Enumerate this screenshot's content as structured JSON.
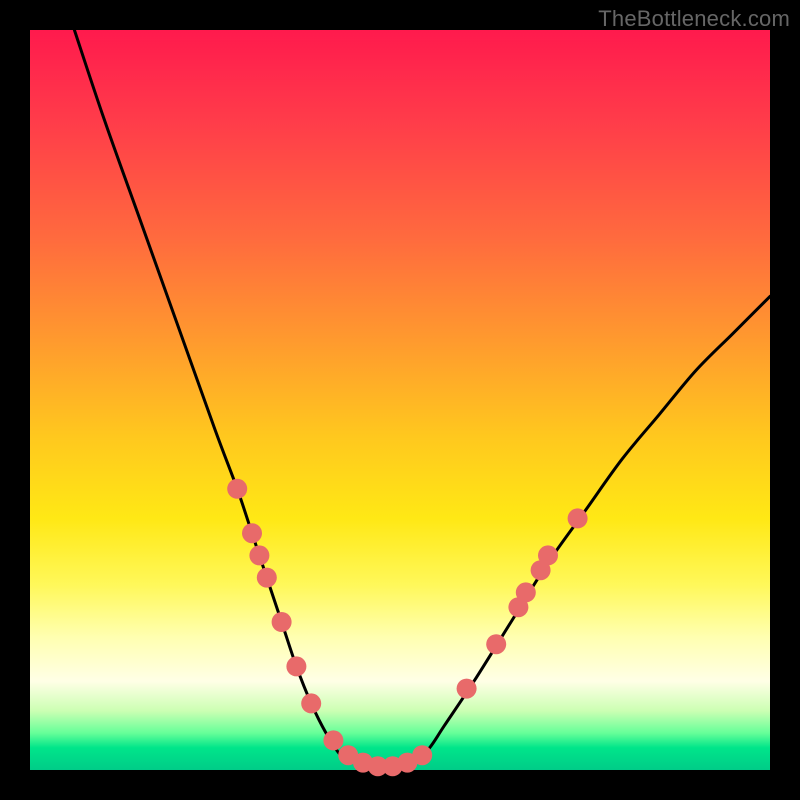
{
  "watermark": "TheBottleneck.com",
  "chart_data": {
    "type": "line",
    "title": "",
    "xlabel": "",
    "ylabel": "",
    "xlim": [
      0,
      100
    ],
    "ylim": [
      0,
      100
    ],
    "grid": false,
    "legend": false,
    "series": [
      {
        "name": "bottleneck-curve",
        "color": "#000000",
        "x": [
          6,
          10,
          15,
          20,
          25,
          28,
          30,
          32,
          34,
          36,
          38,
          40,
          42,
          44,
          46,
          48,
          50,
          52,
          54,
          56,
          60,
          65,
          70,
          75,
          80,
          85,
          90,
          95,
          100
        ],
        "y": [
          100,
          88,
          74,
          60,
          46,
          38,
          32,
          26,
          20,
          14,
          9,
          5,
          2,
          1,
          0,
          0,
          0,
          1,
          3,
          6,
          12,
          20,
          28,
          35,
          42,
          48,
          54,
          59,
          64
        ]
      }
    ],
    "markers": [
      {
        "name": "highlighted-points",
        "color": "#e86a6a",
        "radius": 10,
        "points": [
          {
            "x": 28,
            "y": 38
          },
          {
            "x": 30,
            "y": 32
          },
          {
            "x": 31,
            "y": 29
          },
          {
            "x": 32,
            "y": 26
          },
          {
            "x": 34,
            "y": 20
          },
          {
            "x": 36,
            "y": 14
          },
          {
            "x": 38,
            "y": 9
          },
          {
            "x": 41,
            "y": 4
          },
          {
            "x": 43,
            "y": 2
          },
          {
            "x": 45,
            "y": 1
          },
          {
            "x": 47,
            "y": 0.5
          },
          {
            "x": 49,
            "y": 0.5
          },
          {
            "x": 51,
            "y": 1
          },
          {
            "x": 53,
            "y": 2
          },
          {
            "x": 59,
            "y": 11
          },
          {
            "x": 63,
            "y": 17
          },
          {
            "x": 66,
            "y": 22
          },
          {
            "x": 67,
            "y": 24
          },
          {
            "x": 69,
            "y": 27
          },
          {
            "x": 70,
            "y": 29
          },
          {
            "x": 74,
            "y": 34
          }
        ]
      }
    ],
    "background_gradient": {
      "top": "#ff1a4d",
      "mid_high": "#ff9a2e",
      "mid": "#ffe815",
      "mid_low": "#ffffe6",
      "bottom": "#00cc88"
    }
  }
}
